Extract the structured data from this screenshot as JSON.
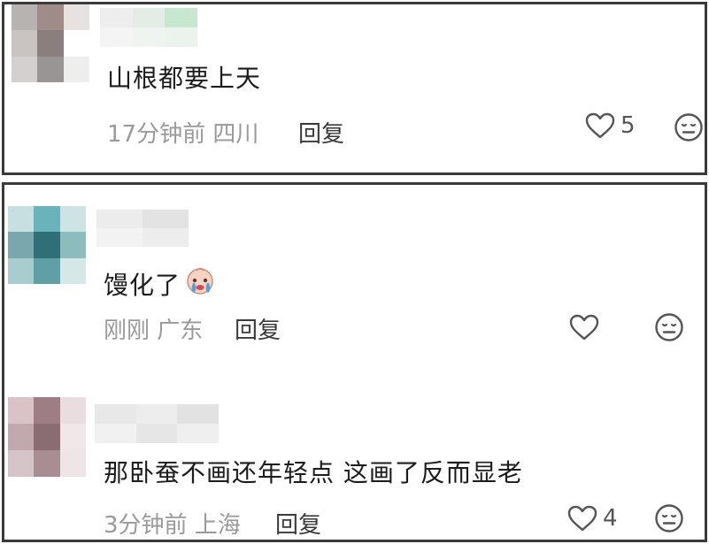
{
  "comments": [
    {
      "text": "山根都要上天",
      "time": "17分钟前",
      "location": "四川",
      "reply_label": "回复",
      "likes": "5",
      "avatar_colors": [
        "#b7b3b0",
        "#9f8c88",
        "#e6e2df",
        "#c9c3c1",
        "#8b7f7d",
        "#ffffff",
        "#d3d0cf",
        "#9a9595",
        "#eeeeee"
      ],
      "username_colors": [
        "#eeeeee",
        "#e4ece6",
        "#c7e8cf",
        "#f4f4f4",
        "#f0f4f1",
        "#eaf3ec"
      ]
    },
    {
      "text": "馒化了",
      "emoji": "crying-face-emoji",
      "time": "刚刚",
      "location": "广东",
      "reply_label": "回复",
      "likes": "",
      "avatar_colors": [
        "#c7dfe0",
        "#6bb3ba",
        "#cfe3e4",
        "#7aa7ac",
        "#2f6f76",
        "#8dbcbf",
        "#a9cccf",
        "#5f9fa5",
        "#d6e7e8"
      ],
      "username_colors": [
        "#ececec",
        "#e3e3e3",
        "#f2f2f2",
        "#ededed"
      ]
    },
    {
      "text": "那卧蚕不画还年轻点 这画了反而显老",
      "time": "3分钟前",
      "location": "上海",
      "reply_label": "回复",
      "likes": "4",
      "avatar_colors": [
        "#d9c3c6",
        "#9e7e84",
        "#e9dde0",
        "#c2a9ad",
        "#8a6d73",
        "#f1e7e9",
        "#d6c5c8",
        "#a88d92",
        "#efe5e7"
      ],
      "username_colors": [
        "#e8e8e8",
        "#ececec",
        "#e2e2e2",
        "#f1f1f1",
        "#e6e6e6",
        "#efefef"
      ]
    }
  ]
}
